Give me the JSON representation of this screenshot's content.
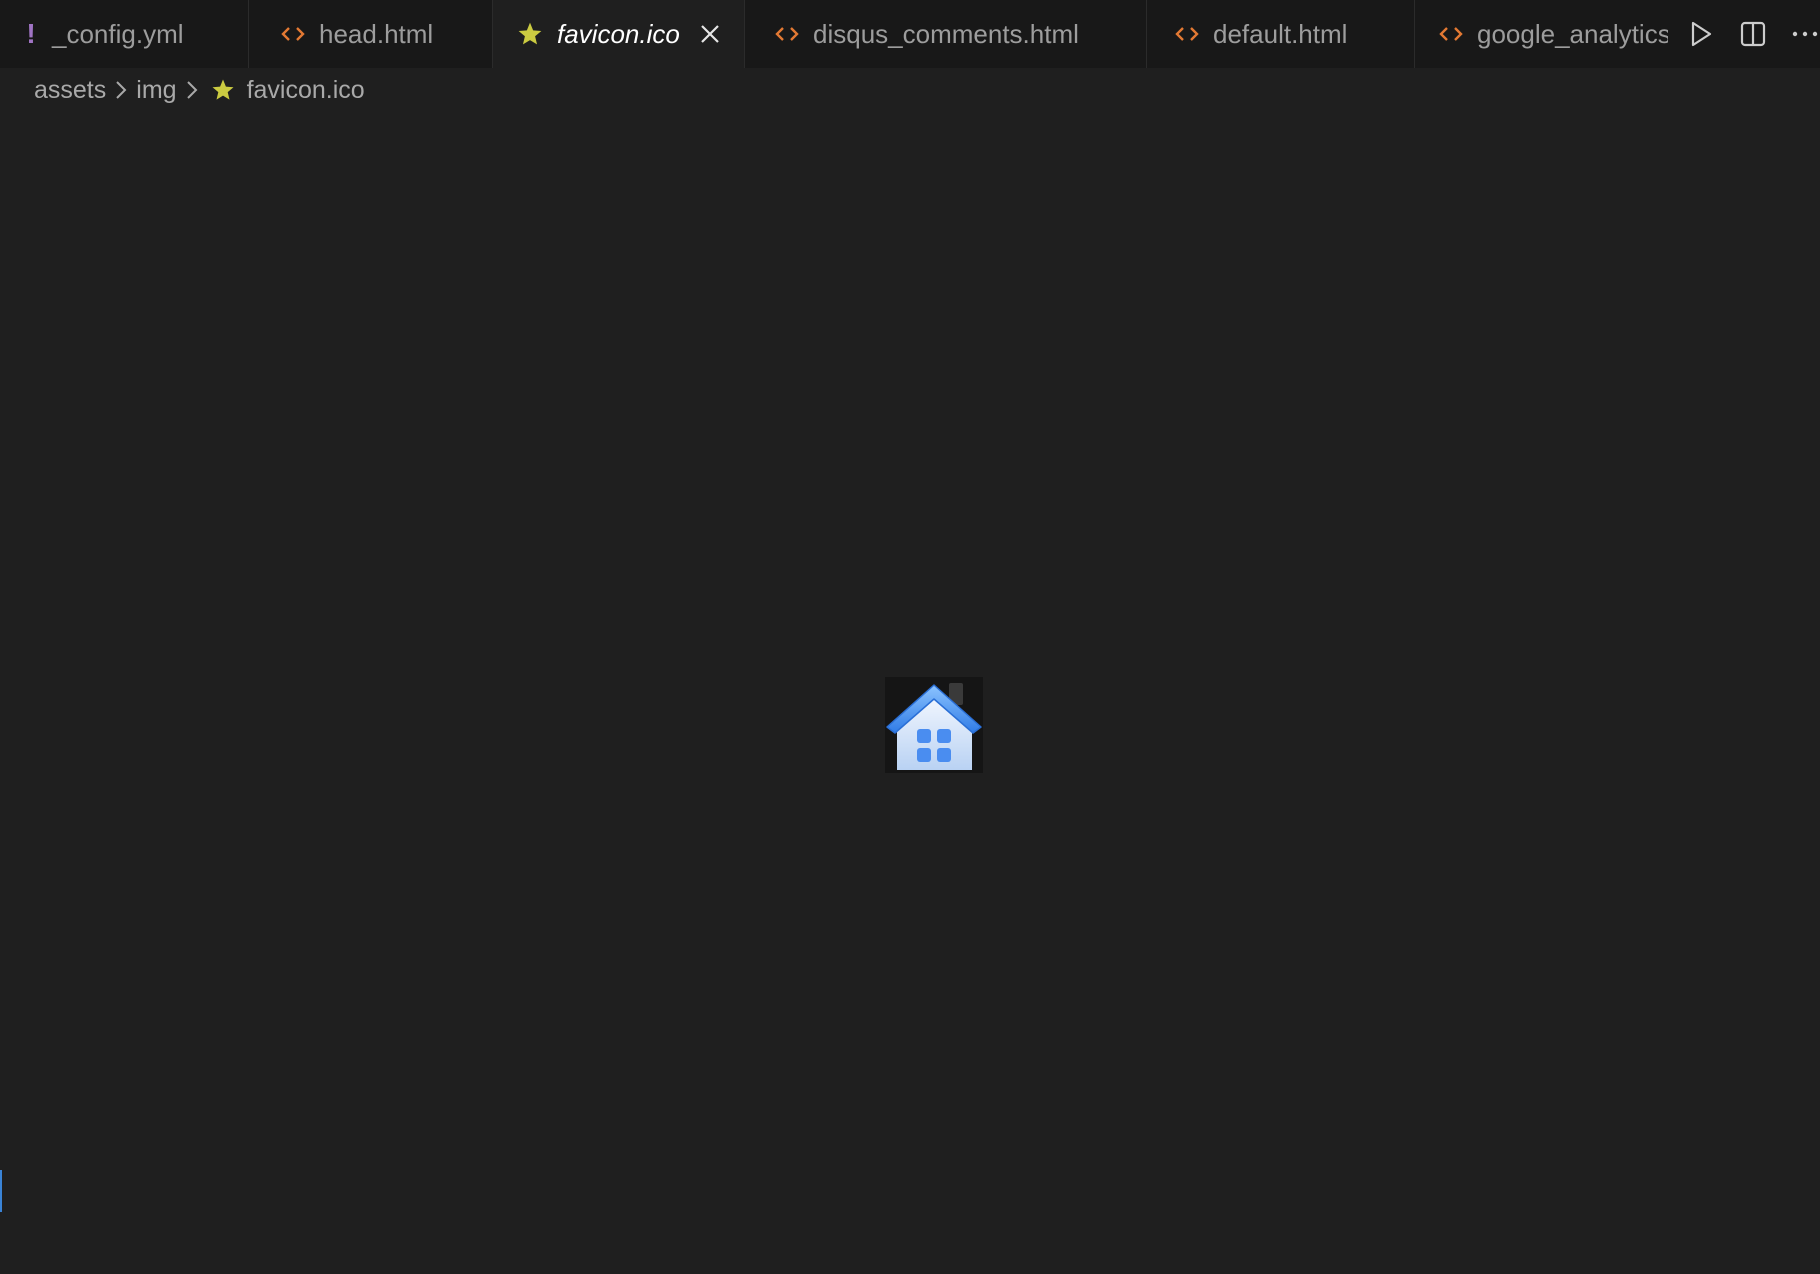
{
  "tabs": [
    {
      "label": "_config.yml",
      "icon": "yaml-exclamation-icon",
      "active": false
    },
    {
      "label": "head.html",
      "icon": "html-brackets-icon",
      "active": false
    },
    {
      "label": "favicon.ico",
      "icon": "star-icon",
      "active": true
    },
    {
      "label": "disqus_comments.html",
      "icon": "html-brackets-icon",
      "active": false
    },
    {
      "label": "default.html",
      "icon": "html-brackets-icon",
      "active": false
    },
    {
      "label": "google_analytics",
      "icon": "html-brackets-icon",
      "active": false
    }
  ],
  "toolbar": {
    "run_icon": "play-icon",
    "split_icon": "split-editor-icon",
    "more_icon": "more-actions-icon"
  },
  "breadcrumb": {
    "items": [
      "assets",
      "img",
      "favicon.ico"
    ]
  },
  "preview": {
    "image_name": "house-favicon-image"
  },
  "colors": {
    "tabbar_bg": "#181818",
    "editor_bg": "#1f1f1f",
    "html_icon": "#e37933",
    "star_icon": "#cbcb41",
    "yaml_icon": "#a074c4",
    "accent": "#3a83d6"
  }
}
